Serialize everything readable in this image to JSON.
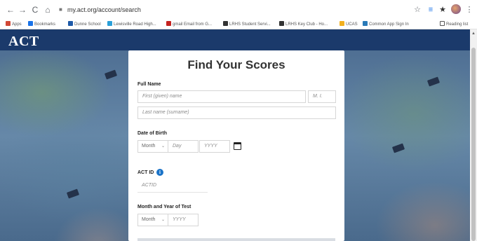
{
  "browser": {
    "url": "my.act.org/account/search",
    "back_icon": "←",
    "forward_icon": "→",
    "reload_icon": "C",
    "home_icon": "⌂",
    "lock_icon": "🔒",
    "star_icon": "☆",
    "menu_icon": "⋮",
    "puzzle_icon": "★"
  },
  "bookmarks": [
    {
      "label": "Apps",
      "color": "#d14836"
    },
    {
      "label": "Bookmarks",
      "color": "#1a73e8"
    },
    {
      "label": "Dunne School",
      "color": "#1e5aa8"
    },
    {
      "label": "Lewisville Road High...",
      "color": "#2a9fd8"
    },
    {
      "label": "gmail Email from G...",
      "color": "#c5221f"
    },
    {
      "label": "LRHS Student Servi...",
      "color": "#333333"
    },
    {
      "label": "LRHS Key Club - Ho...",
      "color": "#333333"
    },
    {
      "label": "UCAS",
      "color": "#f2b01e"
    },
    {
      "label": "Common App Sign In",
      "color": "#2a7ab8"
    },
    {
      "label": "Reading list",
      "color": "#555555"
    }
  ],
  "site": {
    "logo": "ACT"
  },
  "form": {
    "title": "Find Your Scores",
    "full_name_label": "Full Name",
    "first_name_placeholder": "First (given) name",
    "mi_placeholder": "M. I.",
    "last_name_placeholder": "Last name (surname)",
    "dob_label": "Date of Birth",
    "month_select": "Month",
    "day_placeholder": "Day",
    "year_placeholder": "YYYY",
    "act_id_label": "ACT ID",
    "info_icon": "i",
    "act_id_placeholder": "ACTID",
    "test_date_label": "Month and Year of Test",
    "test_month_select": "Month",
    "test_year_placeholder": "YYYY",
    "chevron": "⌄"
  },
  "colors": {
    "header": "#1b3a6b",
    "info": "#1a73c8"
  }
}
